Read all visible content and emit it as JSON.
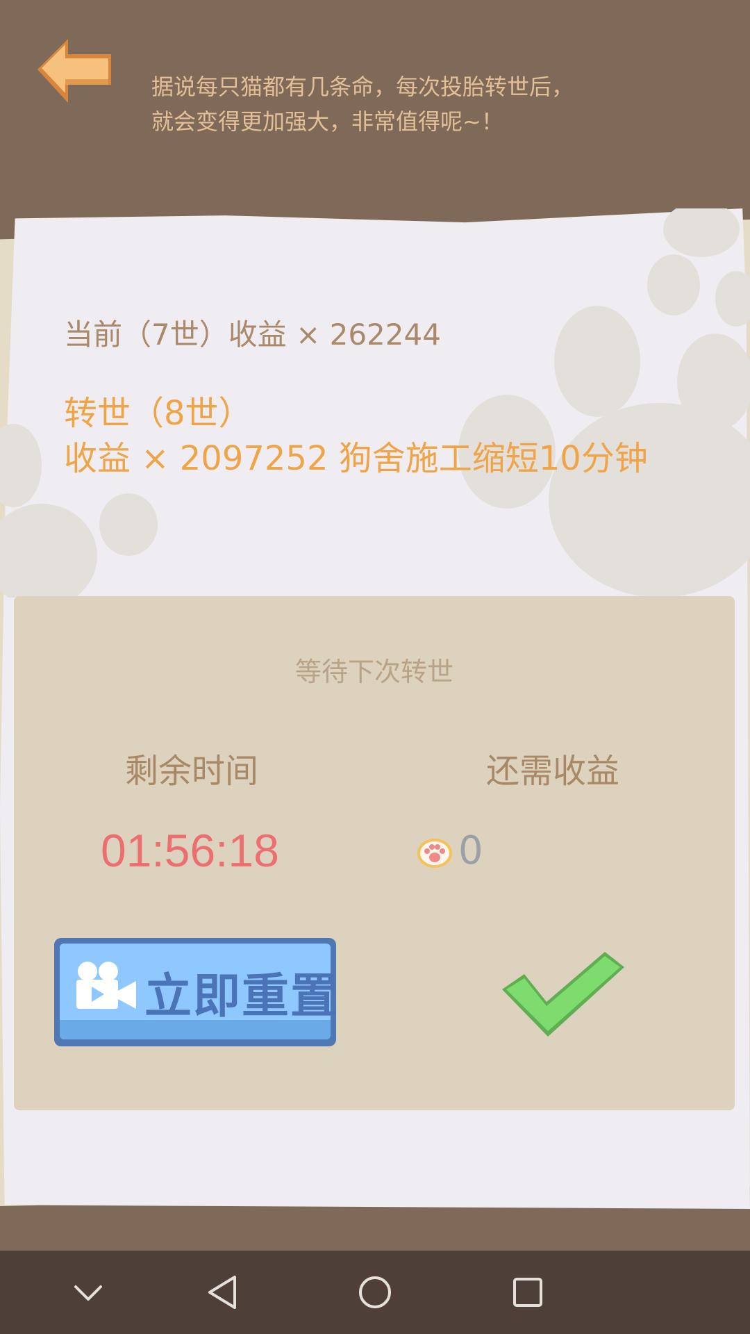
{
  "header": {
    "intro_line1": "据说每只猫都有几条命，每次投胎转世后，",
    "intro_line2": "就会变得更加强大，非常值得呢~！"
  },
  "card": {
    "current_benefit": "当前（7世）收益 × 262244",
    "rebirth_title": "转世（8世）",
    "rebirth_benefit": "收益 × 2097252    狗舍施工缩短10分钟"
  },
  "panel": {
    "title": "等待下次转世",
    "time_label": "剩余时间",
    "income_label": "还需收益",
    "timer": "01:56:18",
    "income_needed": "0",
    "reset_label": "立即重置"
  },
  "icons": {
    "back": "back-arrow-icon",
    "paw": "paw-coin-icon",
    "camera": "video-camera-icon",
    "confirm": "checkmark-icon",
    "nav": [
      "chevron-down-icon",
      "back-triangle-icon",
      "home-circle-icon",
      "recents-square-icon"
    ]
  },
  "colors": {
    "background": "#7f6a5a",
    "paper": "#efedf1",
    "panel": "#dcd2bd",
    "accent_orange": "#f0a448",
    "timer_red": "#ec6e6e",
    "button_blue": "#8ec8ff",
    "check_green": "#7edb6e",
    "navbar": "#4e4038"
  }
}
